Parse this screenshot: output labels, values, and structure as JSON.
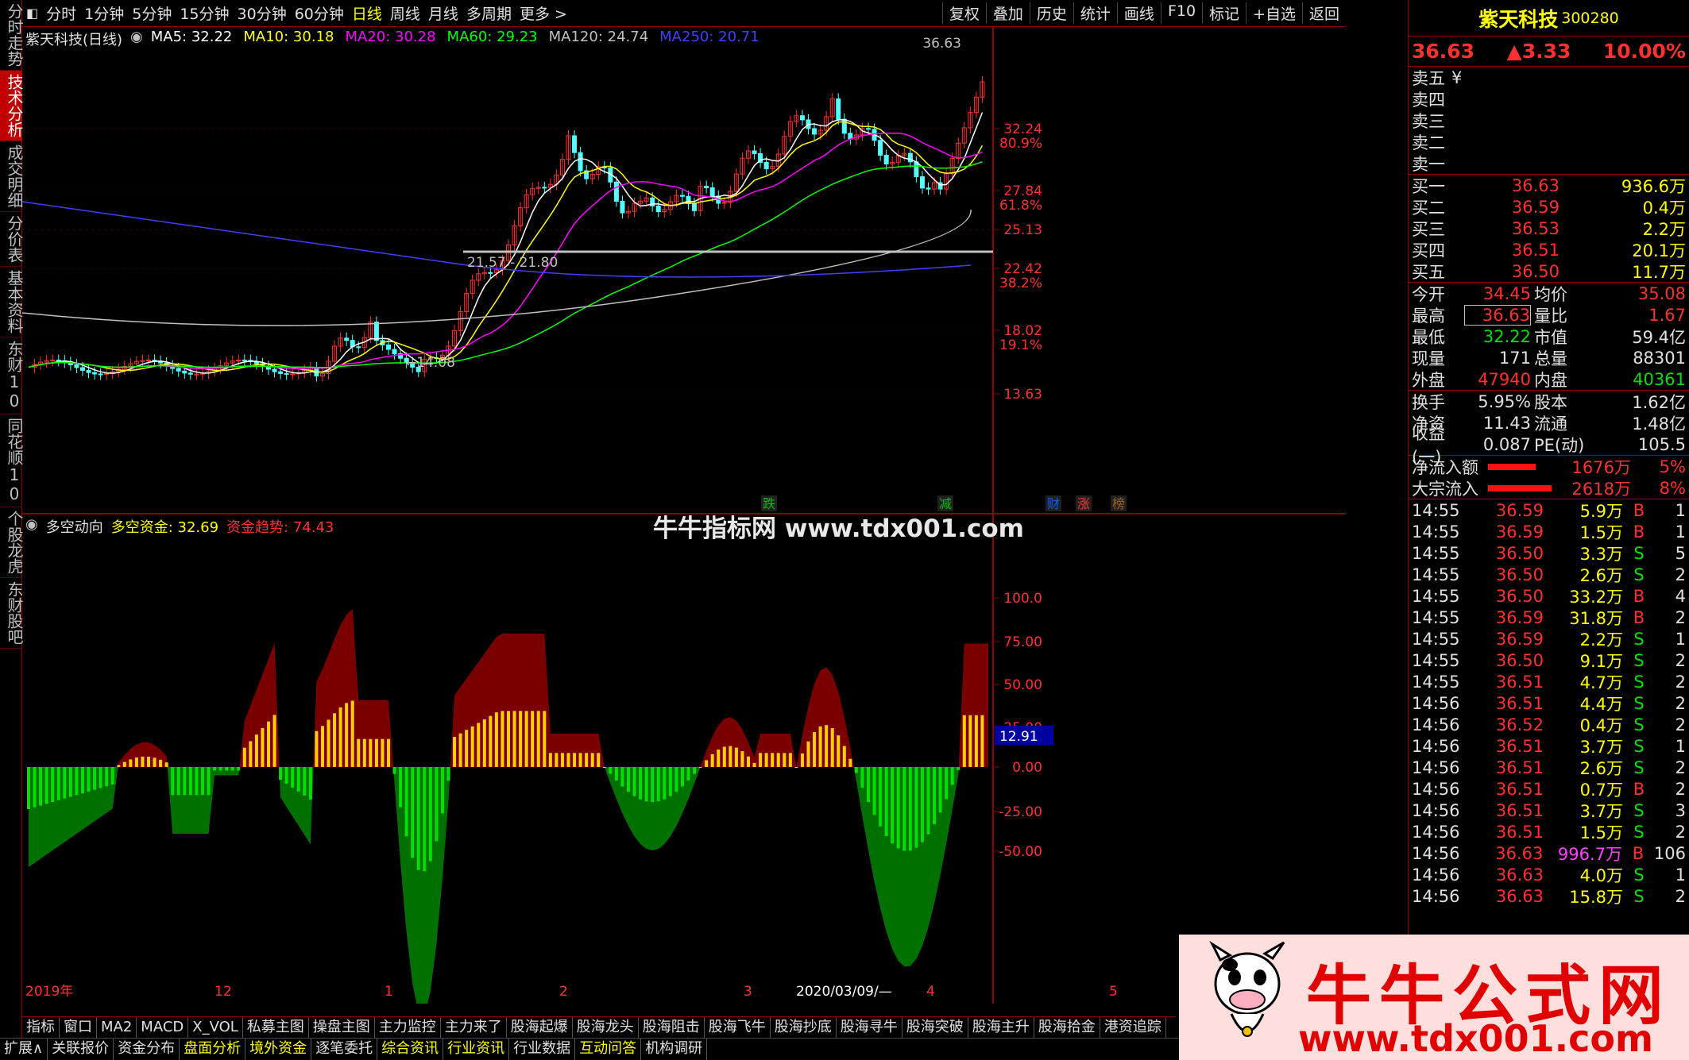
{
  "left_tabs": [
    "分时走势",
    "技术分析",
    "成交明细",
    "分价表",
    "基本资料",
    "东财10",
    "同花顺10",
    "个股龙虎",
    "东财股吧"
  ],
  "left_tab_active": 1,
  "periods": [
    "分时",
    "1分钟",
    "5分钟",
    "15分钟",
    "30分钟",
    "60分钟",
    "日线",
    "周线",
    "月线",
    "多周期",
    "更多 >"
  ],
  "period_active": 6,
  "tools": [
    "复权",
    "叠加",
    "历史",
    "统计",
    "画线",
    "F10",
    "标记",
    "+自选",
    "返回"
  ],
  "chart": {
    "title": "紫天科技(日线)",
    "ma": [
      {
        "label": "MA5: 32.22",
        "color": "#ffffff"
      },
      {
        "label": "MA10: 30.18",
        "color": "#ffff00"
      },
      {
        "label": "MA20: 30.28",
        "color": "#ff00ff"
      },
      {
        "label": "MA60: 29.23",
        "color": "#00ff00"
      },
      {
        "label": "MA120: 24.74",
        "color": "#c0c0c0"
      },
      {
        "label": "MA250: 20.71",
        "color": "#4040ff"
      }
    ],
    "price_ticks": [
      {
        "v": "32.24",
        "p": "80.9%"
      },
      {
        "v": "27.84",
        "p": "61.8%"
      },
      {
        "v": "25.13",
        "p": ""
      },
      {
        "v": "22.42",
        "p": "38.2%"
      },
      {
        "v": "18.02",
        "p": "19.1%"
      },
      {
        "v": "13.63",
        "p": ""
      }
    ],
    "high_label": "36.63",
    "low_label": "14.08",
    "range_label": "21.57 - 21.80",
    "markers": [
      "跌",
      "减",
      "财",
      "涨",
      "榜"
    ]
  },
  "indicator": {
    "name": "多空动向",
    "l1": "多空资金: 32.69",
    "l2": "资金趋势: 74.43",
    "ticks": [
      "100.0",
      "75.00",
      "50.00",
      "25.00",
      "0.00",
      "-25.00",
      "-50.00"
    ],
    "current": "12.91"
  },
  "x_labels": [
    "2019年",
    "12",
    "1",
    "2",
    "3",
    "2020/03/09/—",
    "4",
    "5"
  ],
  "watermark": "牛牛指标网 www.tdx001.com",
  "stock": {
    "name": "紫天科技",
    "code": "300280",
    "price": "36.63",
    "change": "▲3.33",
    "pct": "10.00%"
  },
  "asks": [
    "卖五",
    "卖四",
    "卖三",
    "卖二",
    "卖一"
  ],
  "ask_unit": "¥",
  "bids": [
    [
      "买一",
      "36.63",
      "936.6万"
    ],
    [
      "买二",
      "36.59",
      "0.4万"
    ],
    [
      "买三",
      "36.53",
      "2.2万"
    ],
    [
      "买四",
      "36.51",
      "20.1万"
    ],
    [
      "买五",
      "36.50",
      "11.7万"
    ]
  ],
  "quote": [
    [
      "今开",
      "34.45",
      "均价",
      "35.08"
    ],
    [
      "最高",
      "36.63",
      "量比",
      "1.67"
    ],
    [
      "最低",
      "32.22",
      "市值",
      "59.4亿"
    ],
    [
      "现量",
      "171",
      "总量",
      "88301"
    ],
    [
      "外盘",
      "47940",
      "内盘",
      "40361"
    ]
  ],
  "fund": [
    [
      "换手",
      "5.95%",
      "股本",
      "1.62亿"
    ],
    [
      "净资",
      "11.43",
      "流通",
      "1.48亿"
    ],
    [
      "收益(一)",
      "0.087",
      "PE(动)",
      "105.5"
    ]
  ],
  "flow": [
    [
      "净流入额",
      "1676万",
      "5%"
    ],
    [
      "大宗流入",
      "2618万",
      "8%"
    ]
  ],
  "ticks": [
    [
      "14:55",
      "36.59",
      "5.9万",
      "B",
      "1"
    ],
    [
      "14:55",
      "36.59",
      "1.5万",
      "B",
      "1"
    ],
    [
      "14:55",
      "36.50",
      "3.3万",
      "S",
      "5"
    ],
    [
      "14:55",
      "36.50",
      "2.6万",
      "S",
      "2"
    ],
    [
      "14:55",
      "36.50",
      "33.2万",
      "B",
      "4"
    ],
    [
      "14:55",
      "36.59",
      "31.8万",
      "B",
      "2"
    ],
    [
      "14:55",
      "36.59",
      "2.2万",
      "S",
      "1"
    ],
    [
      "14:55",
      "36.50",
      "9.1万",
      "S",
      "2"
    ],
    [
      "14:55",
      "36.51",
      "4.7万",
      "S",
      "2"
    ],
    [
      "14:56",
      "36.51",
      "4.4万",
      "S",
      "2"
    ],
    [
      "14:56",
      "36.52",
      "0.4万",
      "S",
      "2"
    ],
    [
      "14:56",
      "36.51",
      "3.7万",
      "S",
      "1"
    ],
    [
      "14:56",
      "36.51",
      "2.6万",
      "S",
      "2"
    ],
    [
      "14:56",
      "36.51",
      "0.7万",
      "B",
      "2"
    ],
    [
      "14:56",
      "36.51",
      "3.7万",
      "S",
      "3"
    ],
    [
      "14:56",
      "36.51",
      "1.5万",
      "S",
      "2"
    ],
    [
      "14:56",
      "36.63",
      "996.7万",
      "B",
      "106"
    ],
    [
      "14:56",
      "36.63",
      "4.0万",
      "S",
      "1"
    ],
    [
      "14:56",
      "36.63",
      "15.8万",
      "S",
      "2"
    ]
  ],
  "bottom_tabs1": [
    "指标",
    "窗口",
    "MA2",
    "MACD",
    "X_VOL",
    "私募主图",
    "操盘主图",
    "主力监控",
    "主力来了",
    "股海起爆",
    "股海龙头",
    "股海阻击",
    "股海飞牛",
    "股海抄底",
    "股海寻牛",
    "股海突破",
    "股海主升",
    "股海拾金",
    "港资追踪"
  ],
  "bottom_tabs2": [
    "扩展∧",
    "关联报价",
    "资金分布",
    "盘面分析",
    "境外资金",
    "逐笔委托",
    "综合资讯",
    "行业资讯",
    "行业数据",
    "互动问答",
    "机构调研"
  ],
  "logo": {
    "title": "牛牛公式网",
    "url": "www.tdx001.com"
  }
}
